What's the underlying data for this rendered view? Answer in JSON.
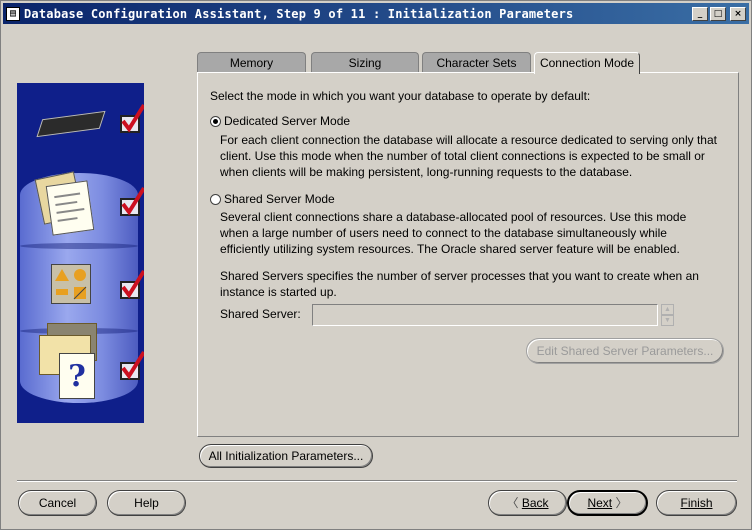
{
  "window": {
    "title": "Database Configuration Assistant, Step 9 of 11 : Initialization Parameters",
    "minimize": "_",
    "maximize": "□",
    "close": "×"
  },
  "tabs": [
    {
      "label": "Memory"
    },
    {
      "label": "Sizing"
    },
    {
      "label": "Character Sets"
    },
    {
      "label": "Connection Mode"
    }
  ],
  "panel": {
    "intro": "Select the mode in which you want your database to operate by default:",
    "dedicated": {
      "label": "Dedicated Server Mode",
      "selected": true,
      "desc": [
        "For each client connection the database will allocate a resource dedicated to serving only that",
        "client.  Use this mode when the number of total client connections is expected to be small or",
        "when clients will be making persistent, long-running requests to the database."
      ]
    },
    "shared": {
      "label": "Shared Server Mode",
      "selected": false,
      "desc": [
        "Several client connections share a database-allocated pool of resources.  Use this mode",
        "when a large number of users need to connect to the database simultaneously while",
        "efficiently utilizing system resources.  The Oracle shared server feature will be enabled."
      ]
    },
    "shared_servers_info": [
      "Shared Servers specifies the number of server processes that you want to create when an",
      "instance is started up."
    ],
    "shared_server_label": "Shared Server:",
    "shared_server_value": "",
    "edit_button": "Edit Shared Server Parameters..."
  },
  "all_params_button": "All Initialization Parameters...",
  "buttons": {
    "cancel": "Cancel",
    "help": "Help",
    "back": "Back",
    "next": "Next",
    "finish": "Finish"
  },
  "colors": {
    "title_bar": "#0a246a",
    "graphic_bg": "#0f1f8a",
    "checkmark": "#cc1020"
  }
}
